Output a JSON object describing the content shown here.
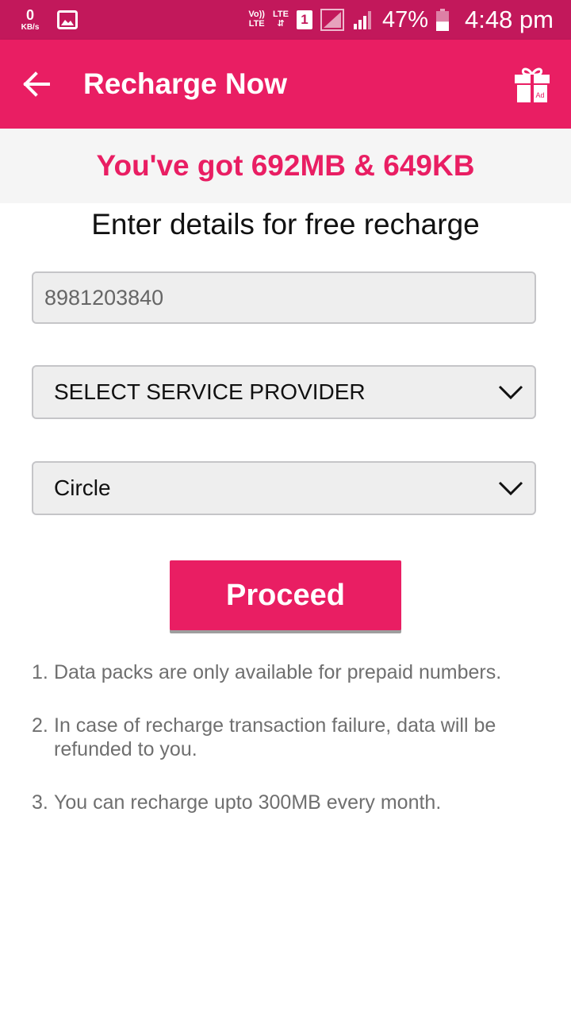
{
  "status_bar": {
    "speed_value": "0",
    "speed_unit": "KB/s",
    "volte_top": "Vo))",
    "volte_bottom": "LTE",
    "lte_label": "LTE",
    "sim_label": "1",
    "battery_percent": "47%",
    "time": "4:48 pm",
    "battery_level": 0.47
  },
  "app_bar": {
    "title": "Recharge Now",
    "gift_badge": "Ad"
  },
  "banner": {
    "text": "You've got 692MB & 649KB"
  },
  "form": {
    "heading": "Enter details for free recharge",
    "phone_value": "8981203840",
    "provider_label": "SELECT SERVICE PROVIDER",
    "circle_label": "Circle",
    "proceed_label": "Proceed"
  },
  "notes": [
    {
      "num": "1.",
      "text": "Data packs are only available for prepaid numbers."
    },
    {
      "num": "2.",
      "text": "In case of recharge transaction failure, data will be refunded to you."
    },
    {
      "num": "3.",
      "text": "You can recharge upto 300MB every month."
    }
  ],
  "colors": {
    "status_bar": "#c2185b",
    "accent": "#e91e63",
    "banner_bg": "#f5f5f5"
  }
}
